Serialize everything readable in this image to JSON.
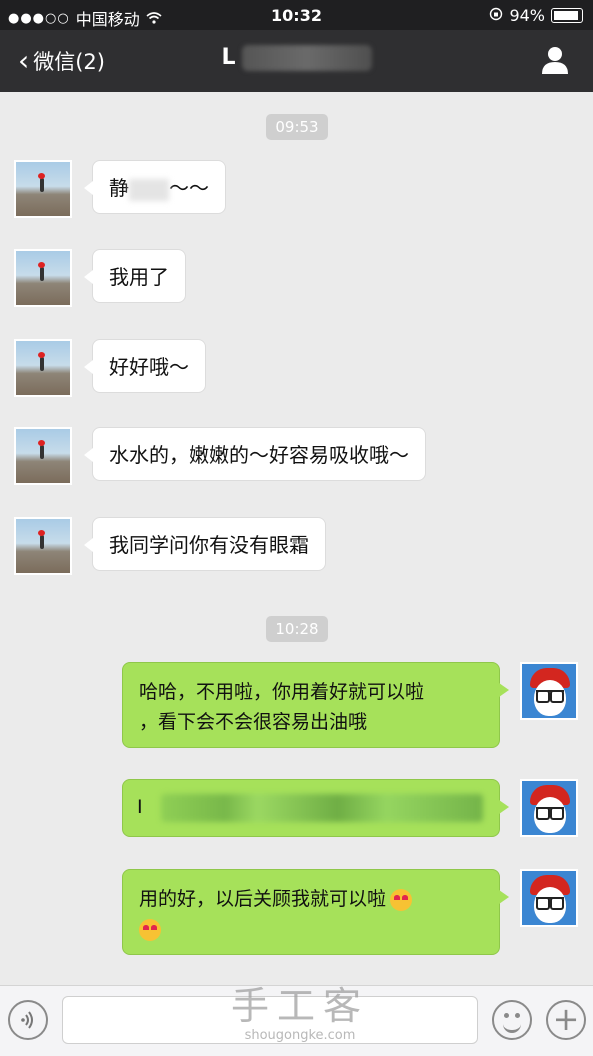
{
  "status_bar": {
    "carrier_dots": "●●●○○",
    "carrier": "中国移动",
    "time": "10:32",
    "battery_percent": "94%",
    "battery_level": 0.94
  },
  "nav": {
    "back_label": "微信(2)",
    "title_visible": "L",
    "contact_icon": "person-icon"
  },
  "chat": {
    "time_stamps": [
      "09:53",
      "10:28"
    ],
    "incoming": [
      {
        "text_start": "静",
        "text_end": "～～"
      },
      {
        "text": "我用了"
      },
      {
        "text": "好好哦～"
      },
      {
        "text": "水水的，嫩嫩的～好容易吸收哦～"
      },
      {
        "text": "我同学问你有没有眼霜"
      }
    ],
    "outgoing": [
      {
        "line1": "哈哈，不用啦，你用着好就可以啦",
        "line2": "，看下会不会很容易出油哦"
      },
      {
        "text_start": "I"
      },
      {
        "text": "用的好，以后关顾我就可以啦"
      }
    ]
  },
  "input_bar": {
    "voice_icon": "voice-icon",
    "emoji_icon": "emoji-icon",
    "plus_icon": "plus-icon"
  },
  "watermark": {
    "title": "手工客",
    "url": "shougongke.com"
  }
}
